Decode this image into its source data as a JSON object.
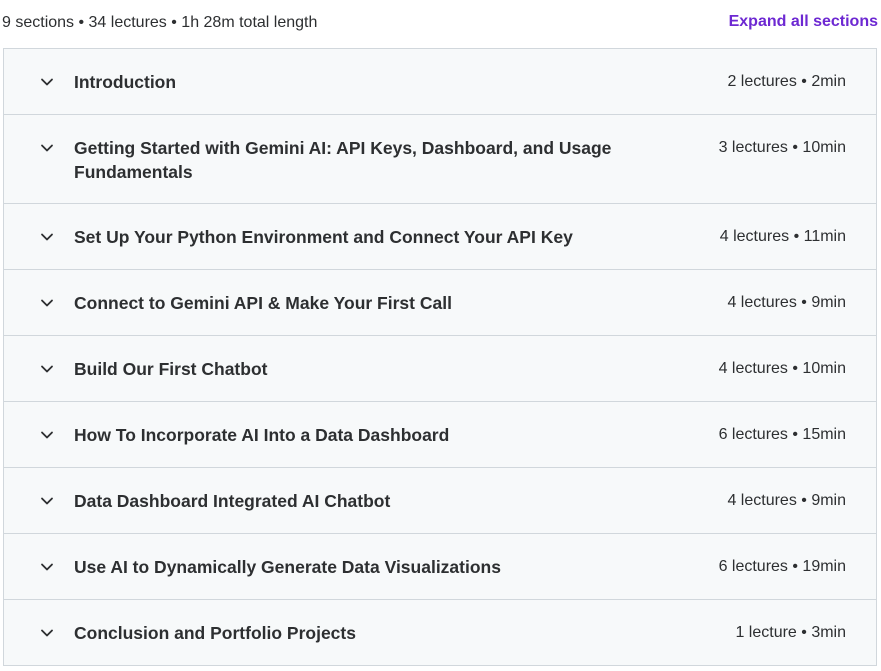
{
  "summary": "9 sections • 34 lectures • 1h 28m total length",
  "expand_label": "Expand all sections",
  "accent_color": "#6d28d2",
  "sections": [
    {
      "title": "Introduction",
      "meta": "2 lectures • 2min",
      "icon": "chevron-down-icon"
    },
    {
      "title": "Getting Started with Gemini AI: API Keys, Dashboard, and Usage Fundamentals",
      "meta": "3 lectures • 10min",
      "icon": "chevron-down-icon"
    },
    {
      "title": "Set Up Your Python Environment and Connect Your API Key",
      "meta": "4 lectures • 11min",
      "icon": "chevron-down-icon"
    },
    {
      "title": "Connect to Gemini API & Make Your First Call",
      "meta": "4 lectures • 9min",
      "icon": "chevron-down-icon"
    },
    {
      "title": "Build Our First Chatbot",
      "meta": "4 lectures • 10min",
      "icon": "chevron-down-icon"
    },
    {
      "title": "How To Incorporate AI Into a Data Dashboard",
      "meta": "6 lectures • 15min",
      "icon": "chevron-down-icon"
    },
    {
      "title": "Data Dashboard Integrated AI Chatbot",
      "meta": "4 lectures • 9min",
      "icon": "chevron-down-icon"
    },
    {
      "title": "Use AI to Dynamically Generate Data Visualizations",
      "meta": "6 lectures • 19min",
      "icon": "chevron-down-icon"
    },
    {
      "title": "Conclusion and Portfolio Projects",
      "meta": "1 lecture • 3min",
      "icon": "chevron-down-icon"
    }
  ]
}
